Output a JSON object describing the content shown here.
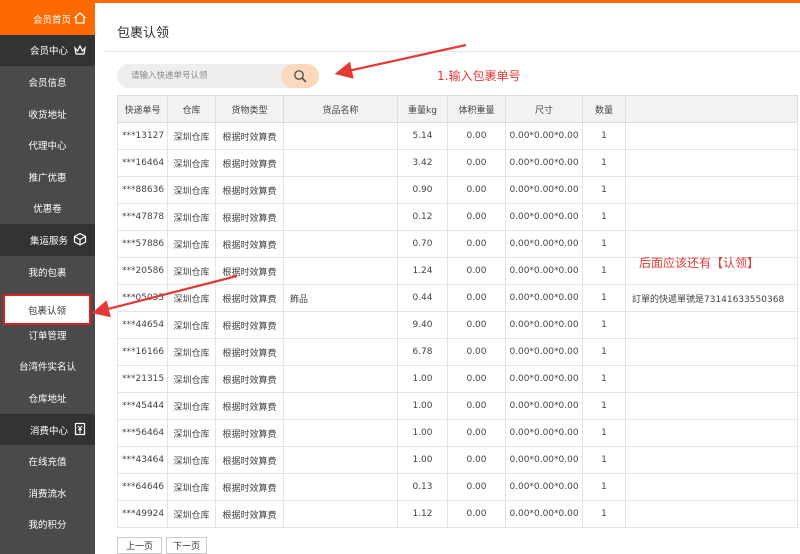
{
  "sidebar": {
    "items": [
      {
        "label": "会员首页",
        "type": "home",
        "icon": "home-icon"
      },
      {
        "label": "会员中心",
        "type": "header",
        "icon": "crown-icon"
      },
      {
        "label": "会员信息",
        "type": "item"
      },
      {
        "label": "收货地址",
        "type": "item"
      },
      {
        "label": "代理中心",
        "type": "item"
      },
      {
        "label": "推广优惠",
        "type": "item"
      },
      {
        "label": "优惠卷",
        "type": "item"
      },
      {
        "label": "集运服务",
        "type": "header",
        "icon": "box-icon"
      },
      {
        "label": "我的包裹",
        "type": "item"
      },
      {
        "label": "包裹认领",
        "type": "active"
      },
      {
        "label": "订单管理",
        "type": "item"
      },
      {
        "label": "台湾件实名认",
        "type": "item"
      },
      {
        "label": "仓库地址",
        "type": "item"
      },
      {
        "label": "消费中心",
        "type": "header",
        "icon": "wallet-icon"
      },
      {
        "label": "在线充值",
        "type": "item"
      },
      {
        "label": "消费流水",
        "type": "item"
      },
      {
        "label": "我的积分",
        "type": "item"
      }
    ]
  },
  "main": {
    "title": "包裹认领",
    "search": {
      "placeholder": "请输入快递单号认领",
      "value": ""
    }
  },
  "table": {
    "headers": [
      "快递单号",
      "仓库",
      "货物类型",
      "货品名称",
      "重量kg",
      "体积重量",
      "尺寸",
      "数量",
      ""
    ],
    "rows": [
      [
        "***13127",
        "深圳仓库",
        "根据时效算费",
        "",
        "5.14",
        "0.00",
        "0.00*0.00*0.00",
        "1",
        ""
      ],
      [
        "***16464",
        "深圳仓库",
        "根据时效算费",
        "",
        "3.42",
        "0.00",
        "0.00*0.00*0.00",
        "1",
        ""
      ],
      [
        "***88636",
        "深圳仓库",
        "根据时效算费",
        "",
        "0.90",
        "0.00",
        "0.00*0.00*0.00",
        "1",
        ""
      ],
      [
        "***47878",
        "深圳仓库",
        "根据时效算费",
        "",
        "0.12",
        "0.00",
        "0.00*0.00*0.00",
        "1",
        ""
      ],
      [
        "***57886",
        "深圳仓库",
        "根据时效算费",
        "",
        "0.70",
        "0.00",
        "0.00*0.00*0.00",
        "1",
        ""
      ],
      [
        "***20586",
        "深圳仓库",
        "根据时效算费",
        "",
        "1.24",
        "0.00",
        "0.00*0.00*0.00",
        "1",
        ""
      ],
      [
        "***05035",
        "深圳仓库",
        "根据时效算费",
        "飾品",
        "0.44",
        "0.00",
        "0.00*0.00*0.00",
        "1",
        "訂單的快遞單號是73141633550368"
      ],
      [
        "***44654",
        "深圳仓库",
        "根据时效算费",
        "",
        "9.40",
        "0.00",
        "0.00*0.00*0.00",
        "1",
        ""
      ],
      [
        "***16166",
        "深圳仓库",
        "根据时效算费",
        "",
        "6.78",
        "0.00",
        "0.00*0.00*0.00",
        "1",
        ""
      ],
      [
        "***21315",
        "深圳仓库",
        "根据时效算费",
        "",
        "1.00",
        "0.00",
        "0.00*0.00*0.00",
        "1",
        ""
      ],
      [
        "***45444",
        "深圳仓库",
        "根据时效算费",
        "",
        "1.00",
        "0.00",
        "0.00*0.00*0.00",
        "1",
        ""
      ],
      [
        "***56464",
        "深圳仓库",
        "根据时效算费",
        "",
        "1.00",
        "0.00",
        "0.00*0.00*0.00",
        "1",
        ""
      ],
      [
        "***43464",
        "深圳仓库",
        "根据时效算费",
        "",
        "1.00",
        "0.00",
        "0.00*0.00*0.00",
        "1",
        ""
      ],
      [
        "***64646",
        "深圳仓库",
        "根据时效算费",
        "",
        "0.13",
        "0.00",
        "0.00*0.00*0.00",
        "1",
        ""
      ],
      [
        "***49924",
        "深圳仓库",
        "根据时效算费",
        "",
        "1.12",
        "0.00",
        "0.00*0.00*0.00",
        "1",
        ""
      ]
    ]
  },
  "pager": {
    "prev": "上一页",
    "next": "下一页"
  },
  "annotations": {
    "step1": "1.输入包裹单号",
    "note": "后面应该还有【认领】",
    "color": "#e53935"
  },
  "colors": {
    "accent": "#ff6a00",
    "sidebar": "#4a4a4a",
    "sidebar_header": "#333333"
  }
}
